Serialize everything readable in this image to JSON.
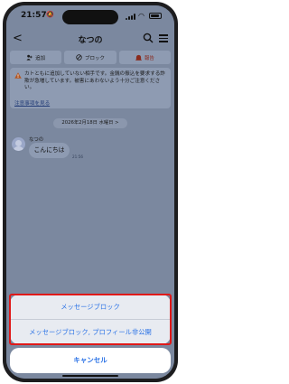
{
  "status": {
    "time": "21:57"
  },
  "header": {
    "back_glyph": "<",
    "title": "なつの"
  },
  "actions": {
    "add": "追加",
    "block": "ブロック",
    "report": "報告"
  },
  "warning": {
    "text": "カトともに追加していない相手です。金銭の振込を要求する詐欺が急増しています。被害にあわないよう十分ご注意ください。",
    "link": "注意事項を見る"
  },
  "chat": {
    "date": "2026年2月18日 水曜日 >",
    "sender": "なつの",
    "message": "こんにちは",
    "time": "21:56"
  },
  "sheet": {
    "option1": "メッセージブロック",
    "option2": "メッセージブロック, プロフィール非公開",
    "cancel": "キャンセル"
  },
  "colors": {
    "accent": "#2a72e6",
    "highlight": "#e01919",
    "report": "#8a2a1d"
  }
}
